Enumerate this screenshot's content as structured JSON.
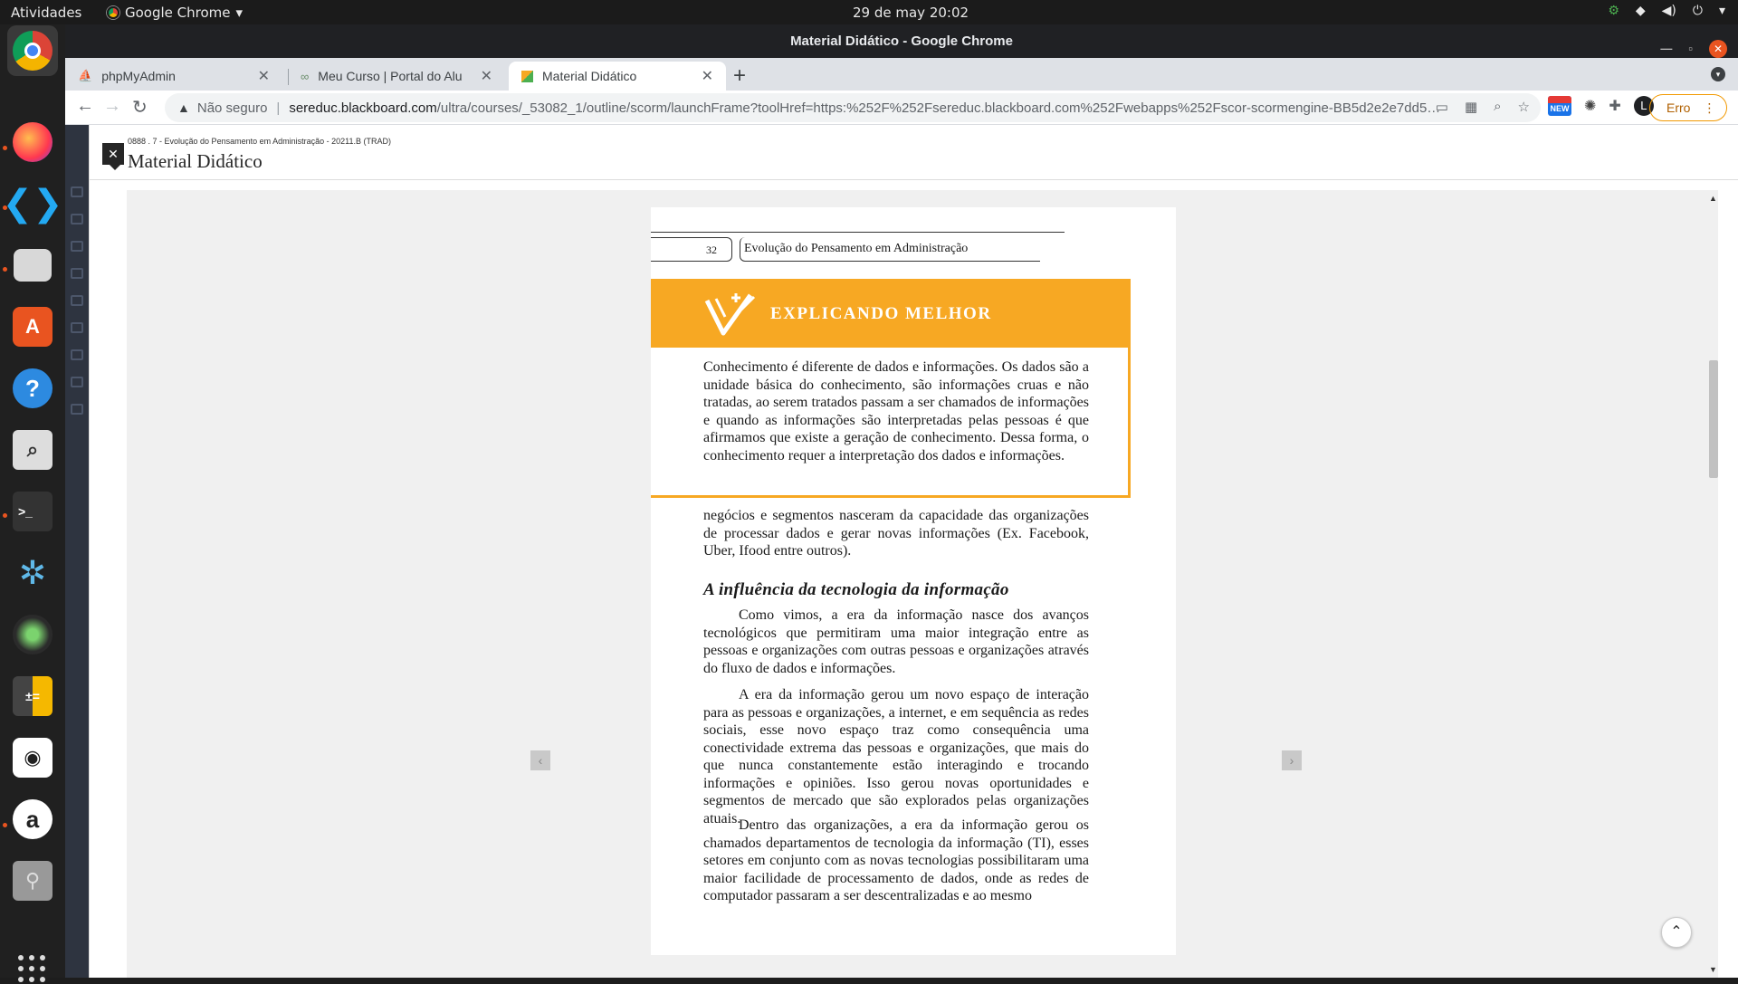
{
  "topbar": {
    "activities": "Atividades",
    "app_name": "Google Chrome",
    "clock": "29 de may  20:02"
  },
  "window": {
    "title": "Material Didático - Google Chrome"
  },
  "tabs": [
    {
      "label": "phpMyAdmin"
    },
    {
      "label": "Meu Curso | Portal do Alu"
    },
    {
      "label": "Material Didático"
    }
  ],
  "address": {
    "not_secure": "Não seguro",
    "host": "sereduc.blackboard.com",
    "path": "/ultra/courses/_53082_1/outline/scorm/launchFrame?toolHref=https:%252F%252Fsereduc.blackboard.com%252Fwebapps%252Fscor-scormengine-BB5d2e2e7dd5953%252F..."
  },
  "extensions": {
    "new_badge": "NEW",
    "profile_initial": "L",
    "error_label": "Erro"
  },
  "panel": {
    "breadcrumb": "0888 . 7 - Evolução do Pensamento em Administração - 20211.B (TRAD)",
    "title": "Material Didático"
  },
  "document": {
    "page_number": "32",
    "running_head": "Evolução do Pensamento em Administração",
    "callout_title": "EXPLICANDO MELHOR",
    "callout_text": "Conhecimento é diferente de dados e informações. Os dados são a unidade básica do conhecimento, são informações cruas e não tratadas, ao serem tratados passam a ser chamados de informações e quando as informações são interpretadas pelas pessoas é que afirmamos que existe a geração de conhecimento. Dessa forma, o conhecimento requer a interpretação dos dados e informações.",
    "para_continuation": "negócios e segmentos nasceram da capacidade das organizações de processar dados e gerar novas informações (Ex. Facebook, Uber, Ifood entre outros).",
    "section_title": "A influência da tecnologia da informação",
    "para_1": "Como vimos, a era da informação nasce dos avanços tecnológicos que permitiram uma maior integração entre as pessoas e organizações com outras pessoas e organizações através do fluxo de dados e informações.",
    "para_2": "A era da informação gerou um novo espaço de interação para as pessoas e organizações, a internet, e em sequência as redes sociais, esse novo espaço traz como consequência uma conectividade extrema das pessoas e organizações, que mais do que nunca constantemente estão interagindo e trocando informações e opiniões. Isso gerou novas oportunidades e segmentos de mercado que são explorados pelas organizações atuais.",
    "para_3": "Dentro das organizações, a era da informação gerou os chamados departamentos de tecnologia da informação (TI), esses setores em conjunto com as novas tecnologias possibilitaram uma maior facilidade de processamento de dados, onde as redes de computador passaram a ser descentralizadas e ao mesmo"
  },
  "colors": {
    "callout_accent": "#f7a823",
    "ubuntu_orange": "#e95420",
    "chrome_dark": "#202124"
  }
}
